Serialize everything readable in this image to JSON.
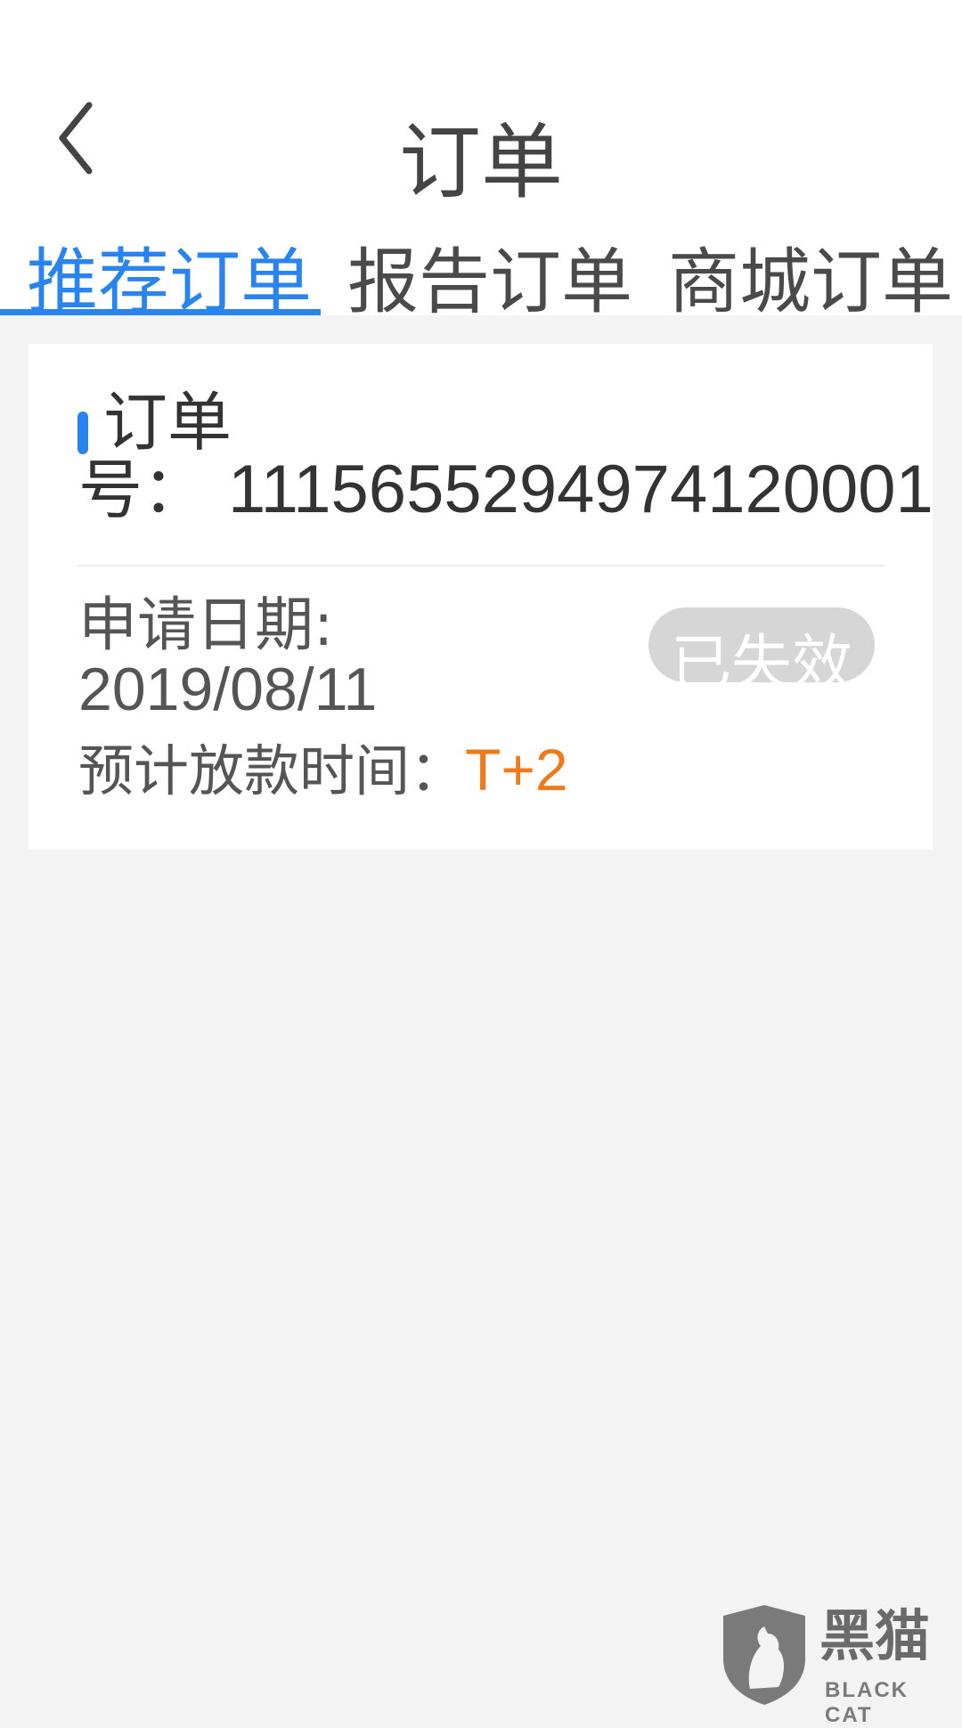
{
  "header": {
    "title": "订单"
  },
  "tabs": [
    {
      "label": "推荐订单",
      "active": true
    },
    {
      "label": "报告订单",
      "active": false
    },
    {
      "label": "商城订单",
      "active": false
    }
  ],
  "order": {
    "label_part1": "订单",
    "label_part2": "号：",
    "number": "1115655294974120001",
    "apply_date_label": "申请日期:",
    "apply_date": "2019/08/11",
    "status": "已失效",
    "loan_time_label": "预计放款时间：",
    "loan_time_value": "T+2"
  },
  "watermark": {
    "text": "黑猫",
    "subtext": "BLACK CAT"
  },
  "colors": {
    "accent": "#2a84f0",
    "highlight": "#f07a1a",
    "status_bg": "#d6d6d6",
    "background": "#f3f3f3"
  }
}
